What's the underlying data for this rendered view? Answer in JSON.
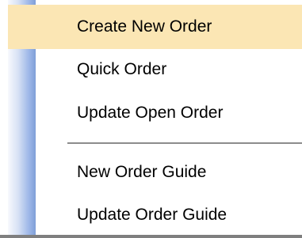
{
  "menu": {
    "items": [
      {
        "label": "Create New Order",
        "highlighted": true
      },
      {
        "label": "Quick Order",
        "highlighted": false
      },
      {
        "label": "Update Open Order",
        "highlighted": false
      },
      {
        "label": "New Order Guide",
        "highlighted": false
      },
      {
        "label": "Update Order Guide",
        "highlighted": false
      }
    ],
    "colors": {
      "highlight": "#fbe6b4",
      "gutter_light": "#d9e3f5",
      "gutter_dark": "#7f9fd8",
      "separator": "#8c8c8c",
      "text": "#000000"
    }
  }
}
